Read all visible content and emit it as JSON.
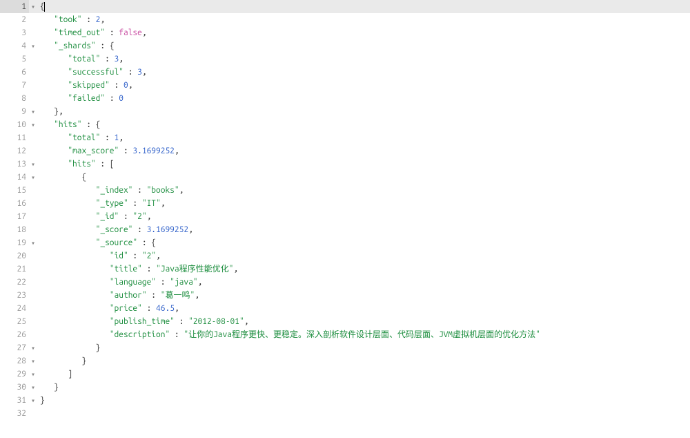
{
  "editor": {
    "active_line": 1,
    "lines": [
      {
        "n": 1,
        "fold": "▾",
        "active": true,
        "tokens": [
          {
            "t": "{",
            "c": "punct"
          },
          {
            "t": "",
            "c": "cursor"
          }
        ]
      },
      {
        "n": 2,
        "fold": "",
        "tokens": [
          {
            "t": "   ",
            "c": ""
          },
          {
            "t": "\"took\"",
            "c": "key"
          },
          {
            "t": " : ",
            "c": "punct"
          },
          {
            "t": "2",
            "c": "num"
          },
          {
            "t": ",",
            "c": "punct"
          }
        ]
      },
      {
        "n": 3,
        "fold": "",
        "tokens": [
          {
            "t": "   ",
            "c": ""
          },
          {
            "t": "\"timed_out\"",
            "c": "key"
          },
          {
            "t": " : ",
            "c": "punct"
          },
          {
            "t": "false",
            "c": "kw"
          },
          {
            "t": ",",
            "c": "punct"
          }
        ]
      },
      {
        "n": 4,
        "fold": "▾",
        "tokens": [
          {
            "t": "   ",
            "c": ""
          },
          {
            "t": "\"_shards\"",
            "c": "key"
          },
          {
            "t": " : ",
            "c": "punct"
          },
          {
            "t": "{",
            "c": "punct"
          }
        ]
      },
      {
        "n": 5,
        "fold": "",
        "tokens": [
          {
            "t": "      ",
            "c": ""
          },
          {
            "t": "\"total\"",
            "c": "key"
          },
          {
            "t": " : ",
            "c": "punct"
          },
          {
            "t": "3",
            "c": "num"
          },
          {
            "t": ",",
            "c": "punct"
          }
        ]
      },
      {
        "n": 6,
        "fold": "",
        "tokens": [
          {
            "t": "      ",
            "c": ""
          },
          {
            "t": "\"successful\"",
            "c": "key"
          },
          {
            "t": " : ",
            "c": "punct"
          },
          {
            "t": "3",
            "c": "num"
          },
          {
            "t": ",",
            "c": "punct"
          }
        ]
      },
      {
        "n": 7,
        "fold": "",
        "tokens": [
          {
            "t": "      ",
            "c": ""
          },
          {
            "t": "\"skipped\"",
            "c": "key"
          },
          {
            "t": " : ",
            "c": "punct"
          },
          {
            "t": "0",
            "c": "num"
          },
          {
            "t": ",",
            "c": "punct"
          }
        ]
      },
      {
        "n": 8,
        "fold": "",
        "tokens": [
          {
            "t": "      ",
            "c": ""
          },
          {
            "t": "\"failed\"",
            "c": "key"
          },
          {
            "t": " : ",
            "c": "punct"
          },
          {
            "t": "0",
            "c": "num"
          }
        ]
      },
      {
        "n": 9,
        "fold": "▾",
        "tokens": [
          {
            "t": "   ",
            "c": ""
          },
          {
            "t": "},",
            "c": "punct"
          }
        ]
      },
      {
        "n": 10,
        "fold": "▾",
        "tokens": [
          {
            "t": "   ",
            "c": ""
          },
          {
            "t": "\"hits\"",
            "c": "key"
          },
          {
            "t": " : ",
            "c": "punct"
          },
          {
            "t": "{",
            "c": "punct"
          }
        ]
      },
      {
        "n": 11,
        "fold": "",
        "tokens": [
          {
            "t": "      ",
            "c": ""
          },
          {
            "t": "\"total\"",
            "c": "key"
          },
          {
            "t": " : ",
            "c": "punct"
          },
          {
            "t": "1",
            "c": "num"
          },
          {
            "t": ",",
            "c": "punct"
          }
        ]
      },
      {
        "n": 12,
        "fold": "",
        "tokens": [
          {
            "t": "      ",
            "c": ""
          },
          {
            "t": "\"max_score\"",
            "c": "key"
          },
          {
            "t": " : ",
            "c": "punct"
          },
          {
            "t": "3.1699252",
            "c": "num"
          },
          {
            "t": ",",
            "c": "punct"
          }
        ]
      },
      {
        "n": 13,
        "fold": "▾",
        "tokens": [
          {
            "t": "      ",
            "c": ""
          },
          {
            "t": "\"hits\"",
            "c": "key"
          },
          {
            "t": " : ",
            "c": "punct"
          },
          {
            "t": "[",
            "c": "punct"
          }
        ]
      },
      {
        "n": 14,
        "fold": "▾",
        "tokens": [
          {
            "t": "         ",
            "c": ""
          },
          {
            "t": "{",
            "c": "punct"
          }
        ]
      },
      {
        "n": 15,
        "fold": "",
        "tokens": [
          {
            "t": "            ",
            "c": ""
          },
          {
            "t": "\"_index\"",
            "c": "key"
          },
          {
            "t": " : ",
            "c": "punct"
          },
          {
            "t": "\"books\"",
            "c": "str"
          },
          {
            "t": ",",
            "c": "punct"
          }
        ]
      },
      {
        "n": 16,
        "fold": "",
        "tokens": [
          {
            "t": "            ",
            "c": ""
          },
          {
            "t": "\"_type\"",
            "c": "key"
          },
          {
            "t": " : ",
            "c": "punct"
          },
          {
            "t": "\"IT\"",
            "c": "str"
          },
          {
            "t": ",",
            "c": "punct"
          }
        ]
      },
      {
        "n": 17,
        "fold": "",
        "tokens": [
          {
            "t": "            ",
            "c": ""
          },
          {
            "t": "\"_id\"",
            "c": "key"
          },
          {
            "t": " : ",
            "c": "punct"
          },
          {
            "t": "\"2\"",
            "c": "str"
          },
          {
            "t": ",",
            "c": "punct"
          }
        ]
      },
      {
        "n": 18,
        "fold": "",
        "tokens": [
          {
            "t": "            ",
            "c": ""
          },
          {
            "t": "\"_score\"",
            "c": "key"
          },
          {
            "t": " : ",
            "c": "punct"
          },
          {
            "t": "3.1699252",
            "c": "num"
          },
          {
            "t": ",",
            "c": "punct"
          }
        ]
      },
      {
        "n": 19,
        "fold": "▾",
        "tokens": [
          {
            "t": "            ",
            "c": ""
          },
          {
            "t": "\"_source\"",
            "c": "key"
          },
          {
            "t": " : ",
            "c": "punct"
          },
          {
            "t": "{",
            "c": "punct"
          }
        ]
      },
      {
        "n": 20,
        "fold": "",
        "tokens": [
          {
            "t": "               ",
            "c": ""
          },
          {
            "t": "\"id\"",
            "c": "key"
          },
          {
            "t": " : ",
            "c": "punct"
          },
          {
            "t": "\"2\"",
            "c": "str"
          },
          {
            "t": ",",
            "c": "punct"
          }
        ]
      },
      {
        "n": 21,
        "fold": "",
        "tokens": [
          {
            "t": "               ",
            "c": ""
          },
          {
            "t": "\"title\"",
            "c": "key"
          },
          {
            "t": " : ",
            "c": "punct"
          },
          {
            "t": "\"Java程序性能优化\"",
            "c": "str"
          },
          {
            "t": ",",
            "c": "punct"
          }
        ]
      },
      {
        "n": 22,
        "fold": "",
        "tokens": [
          {
            "t": "               ",
            "c": ""
          },
          {
            "t": "\"language\"",
            "c": "key"
          },
          {
            "t": " : ",
            "c": "punct"
          },
          {
            "t": "\"java\"",
            "c": "str"
          },
          {
            "t": ",",
            "c": "punct"
          }
        ]
      },
      {
        "n": 23,
        "fold": "",
        "tokens": [
          {
            "t": "               ",
            "c": ""
          },
          {
            "t": "\"author\"",
            "c": "key"
          },
          {
            "t": " : ",
            "c": "punct"
          },
          {
            "t": "\"葛一鸣\"",
            "c": "str"
          },
          {
            "t": ",",
            "c": "punct"
          }
        ]
      },
      {
        "n": 24,
        "fold": "",
        "tokens": [
          {
            "t": "               ",
            "c": ""
          },
          {
            "t": "\"price\"",
            "c": "key"
          },
          {
            "t": " : ",
            "c": "punct"
          },
          {
            "t": "46.5",
            "c": "num"
          },
          {
            "t": ",",
            "c": "punct"
          }
        ]
      },
      {
        "n": 25,
        "fold": "",
        "tokens": [
          {
            "t": "               ",
            "c": ""
          },
          {
            "t": "\"publish_time\"",
            "c": "key"
          },
          {
            "t": " : ",
            "c": "punct"
          },
          {
            "t": "\"2012-08-01\"",
            "c": "str"
          },
          {
            "t": ",",
            "c": "punct"
          }
        ]
      },
      {
        "n": 26,
        "fold": "",
        "tokens": [
          {
            "t": "               ",
            "c": ""
          },
          {
            "t": "\"description\"",
            "c": "key"
          },
          {
            "t": " : ",
            "c": "punct"
          },
          {
            "t": "\"让你的Java程序更快、更稳定。深入剖析软件设计层面、代码层面、JVM虚拟机层面的优化方法\"",
            "c": "str"
          }
        ]
      },
      {
        "n": 27,
        "fold": "▾",
        "tokens": [
          {
            "t": "            ",
            "c": ""
          },
          {
            "t": "}",
            "c": "punct"
          }
        ]
      },
      {
        "n": 28,
        "fold": "▾",
        "tokens": [
          {
            "t": "         ",
            "c": ""
          },
          {
            "t": "}",
            "c": "punct"
          }
        ]
      },
      {
        "n": 29,
        "fold": "▾",
        "tokens": [
          {
            "t": "      ",
            "c": ""
          },
          {
            "t": "]",
            "c": "punct"
          }
        ]
      },
      {
        "n": 30,
        "fold": "▾",
        "tokens": [
          {
            "t": "   ",
            "c": ""
          },
          {
            "t": "}",
            "c": "punct"
          }
        ]
      },
      {
        "n": 31,
        "fold": "▾",
        "tokens": [
          {
            "t": "}",
            "c": "punct"
          }
        ]
      },
      {
        "n": 32,
        "fold": "",
        "tokens": [
          {
            "t": "",
            "c": ""
          }
        ]
      }
    ]
  }
}
